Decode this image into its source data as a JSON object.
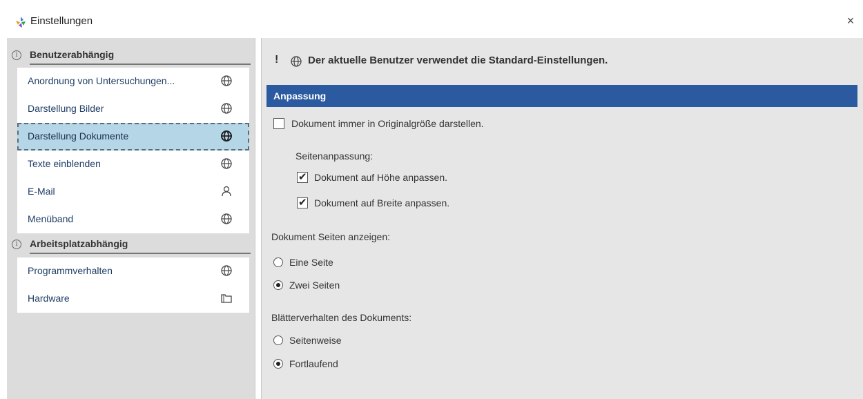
{
  "window": {
    "title": "Einstellungen",
    "close_label": "×"
  },
  "sidebar": {
    "groups": [
      {
        "label": "Benutzerabhängig",
        "items": [
          {
            "label": "Anordnung von Untersuchungen...",
            "icon": "globe-icon"
          },
          {
            "label": "Darstellung Bilder",
            "icon": "globe-icon"
          },
          {
            "label": "Darstellung Dokumente",
            "icon": "globe-icon",
            "selected": true
          },
          {
            "label": "Texte einblenden",
            "icon": "globe-icon"
          },
          {
            "label": "E-Mail",
            "icon": "user-icon"
          },
          {
            "label": "Menüband",
            "icon": "globe-icon"
          }
        ]
      },
      {
        "label": "Arbeitsplatzabhängig",
        "items": [
          {
            "label": "Programmverhalten",
            "icon": "globe-icon"
          },
          {
            "label": "Hardware",
            "icon": "folder-icon"
          }
        ]
      }
    ]
  },
  "main": {
    "notice_mark": "!",
    "notice": "Der aktuelle Benutzer verwendet die Standard-Einstellungen.",
    "section_title": "Anpassung",
    "original_size": {
      "label": "Dokument immer in Originalgröße darstellen.",
      "checked": false
    },
    "fit_heading": "Seitenanpassung:",
    "fit_height": {
      "label": "Dokument auf Höhe anpassen.",
      "checked": true
    },
    "fit_width": {
      "label": "Dokument auf Breite anpassen.",
      "checked": true
    },
    "pages_heading": "Dokument Seiten anzeigen:",
    "pages_options": [
      {
        "label": "Eine Seite",
        "selected": false
      },
      {
        "label": "Zwei Seiten",
        "selected": true
      }
    ],
    "scroll_heading": "Blätterverhalten des Dokuments:",
    "scroll_options": [
      {
        "label": "Seitenweise",
        "selected": false
      },
      {
        "label": "Fortlaufend",
        "selected": true
      }
    ]
  },
  "colors": {
    "accent": "#2c5aa0",
    "selected_bg": "#b5d6e6",
    "sidebar_bg": "#dcdcdc",
    "panel_bg": "#e6e6e6"
  }
}
